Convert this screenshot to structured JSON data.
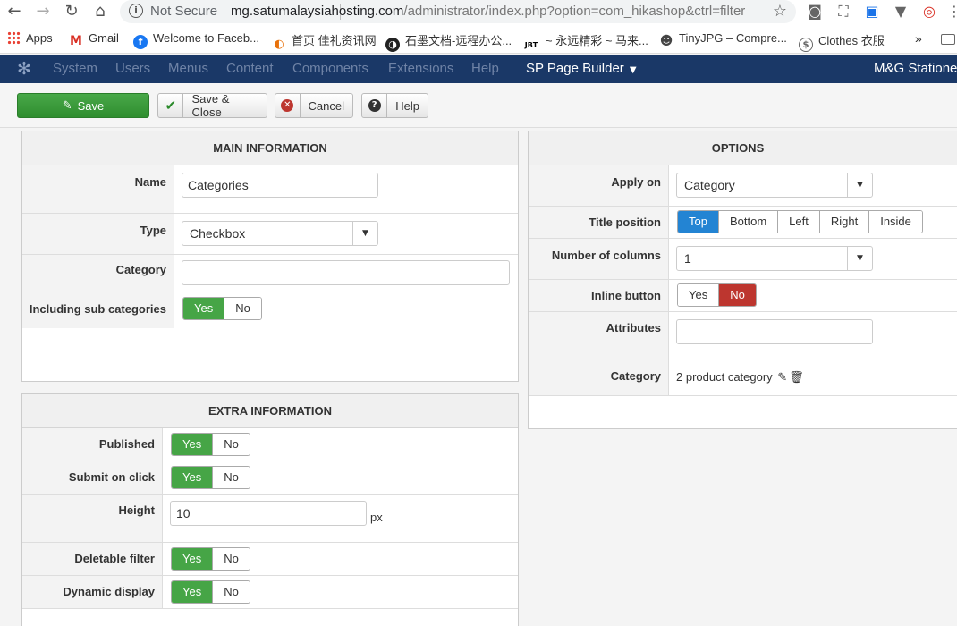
{
  "browser": {
    "secure_label": "Not Secure",
    "url_host": "mg.satumalaysiahosting.com",
    "url_path": "/administrator/index.php?option=com_hikashop&ctrl=filter",
    "bookmarks": [
      {
        "label": "Apps",
        "icon": "apps-grid-icon"
      },
      {
        "label": "Gmail",
        "icon": "gmail-icon",
        "glyph": "M",
        "color": "#d93025"
      },
      {
        "label": "Welcome to Faceb...",
        "icon": "facebook-icon",
        "glyph": "f",
        "color": "#1877f2"
      },
      {
        "label": "首页 佳礼资讯网",
        "icon": "cari-icon",
        "glyph": "◐",
        "color": "#e8710a"
      },
      {
        "label": "石墨文档-远程办公...",
        "icon": "shimo-icon",
        "glyph": "◑",
        "color": "#222222"
      },
      {
        "label": "~ 永远精彩 ~ 马来...",
        "icon": "jbt-icon",
        "glyph": "JBT",
        "color": "#000000"
      },
      {
        "label": "TinyJPG – Compre...",
        "icon": "panda-icon",
        "glyph": "☻",
        "color": "#444444"
      },
      {
        "label": "Clothes 衣服",
        "icon": "clothes-icon",
        "glyph": "$",
        "color": "#666666"
      }
    ],
    "more": "»"
  },
  "admin_menu": {
    "items": [
      "System",
      "Users",
      "Menus",
      "Content",
      "Components",
      "Extensions",
      "Help"
    ],
    "active": "SP Page Builder",
    "site_name": "M&G Statione"
  },
  "toolbar": {
    "save": "Save",
    "save_close": "Save & Close",
    "cancel": "Cancel",
    "help": "Help"
  },
  "main_info": {
    "title": "MAIN INFORMATION",
    "name_label": "Name",
    "name_value": "Categories",
    "type_label": "Type",
    "type_value": "Checkbox",
    "category_label": "Category",
    "category_value": "",
    "subcat_label": "Including sub categories",
    "yes": "Yes",
    "no": "No"
  },
  "extra_info": {
    "title": "EXTRA INFORMATION",
    "published_label": "Published",
    "submit_label": "Submit on click",
    "height_label": "Height",
    "height_value": "10",
    "height_unit": "px",
    "deletable_label": "Deletable filter",
    "dynamic_label": "Dynamic display",
    "yes": "Yes",
    "no": "No"
  },
  "options": {
    "title": "OPTIONS",
    "apply_label": "Apply on",
    "apply_value": "Category",
    "title_pos_label": "Title position",
    "title_positions": [
      "Top",
      "Bottom",
      "Left",
      "Right",
      "Inside"
    ],
    "title_pos_selected": "Top",
    "columns_label": "Number of columns",
    "columns_value": "1",
    "inline_label": "Inline button",
    "inline_yes": "Yes",
    "inline_no": "No",
    "inline_selected": "No",
    "attributes_label": "Attributes",
    "attributes_value": "",
    "category_label": "Category",
    "category_value": "2 product category"
  },
  "colors": {
    "admin_nav": "#1a3867",
    "toggle_green": "#46a546",
    "toggle_red": "#bd362f",
    "toggle_blue": "#2384d3"
  }
}
